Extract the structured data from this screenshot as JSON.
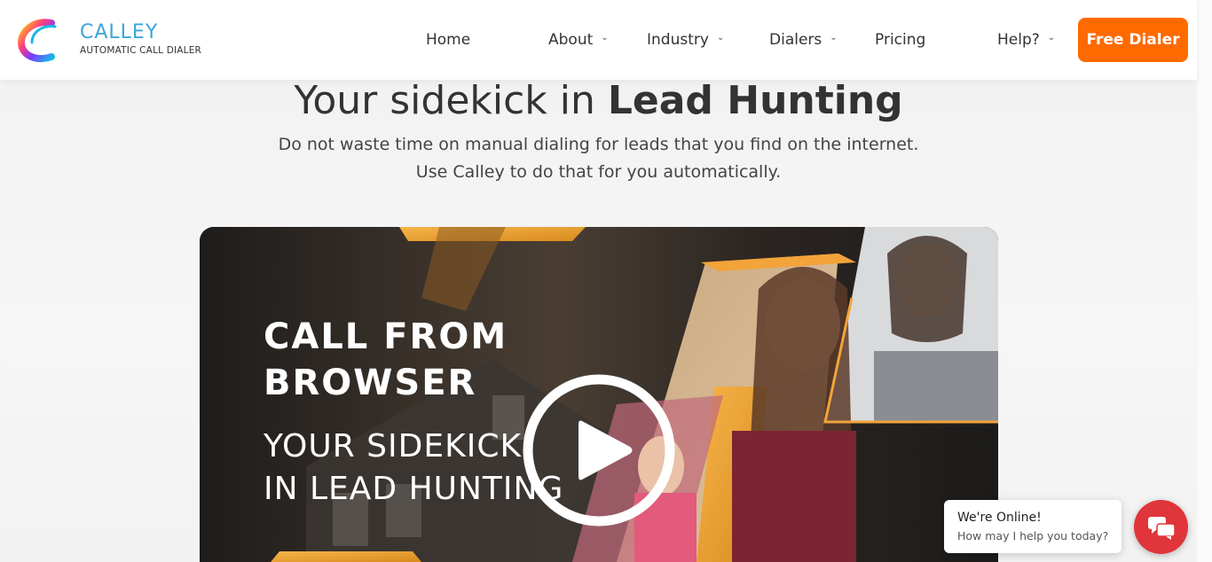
{
  "brand": {
    "name": "CALLEY",
    "tagline": "AUTOMATIC CALL DIALER"
  },
  "nav": {
    "home": "Home",
    "about": "About",
    "industry": "Industry",
    "dialers": "Dialers",
    "pricing": "Pricing",
    "help": "Help?",
    "cta": "Free Dialer"
  },
  "hero": {
    "title_plain": "Your sidekick in ",
    "title_bold": "Lead Hunting",
    "sub_line1": "Do not waste time on manual dialing for leads that you find on the internet.",
    "sub_line2": "Use Calley to do that for you automatically."
  },
  "video": {
    "line1": "CALL FROM",
    "line2": "BROWSER",
    "line3": "YOUR SIDEKICK",
    "line4": "IN LEAD HUNTING"
  },
  "chat": {
    "status": "We're Online!",
    "prompt": "How may I help you today?"
  },
  "colors": {
    "accent": "#ff6a00",
    "chat": "#e0353a",
    "logo_blue": "#3aa6d8",
    "video_gold": "#f2a33a"
  },
  "icons": {
    "dropdown": "chevron-down-icon",
    "play": "play-icon",
    "chat": "chat-icon"
  }
}
